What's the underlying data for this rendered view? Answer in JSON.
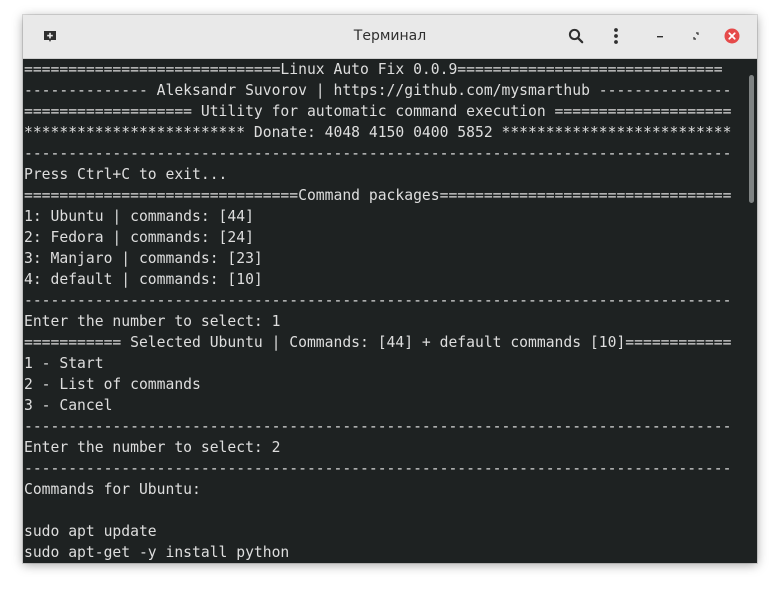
{
  "window": {
    "title": "Терминал"
  },
  "terminal": {
    "lines": [
      "=============================Linux Auto Fix 0.0.9==============================",
      "-------------- Aleksandr Suvorov | https://github.com/mysmarthub ---------------",
      "=================== Utility for automatic command execution ====================",
      "************************* Donate: 4048 4150 0400 5852 **************************",
      "--------------------------------------------------------------------------------",
      "Press Ctrl+C to exit...",
      "===============================Command packages=================================",
      "1: Ubuntu | commands: [44]",
      "2: Fedora | commands: [24]",
      "3: Manjaro | commands: [23]",
      "4: default | commands: [10]",
      "--------------------------------------------------------------------------------",
      "Enter the number to select: 1",
      "=========== Selected Ubuntu | Commands: [44] + default commands [10]============",
      "1 - Start",
      "2 - List of commands",
      "3 - Cancel",
      "--------------------------------------------------------------------------------",
      "Enter the number to select: 2",
      "--------------------------------------------------------------------------------",
      "Commands for Ubuntu:",
      "",
      "sudo apt update",
      "sudo apt-get -y install python"
    ]
  },
  "icons": {
    "new_tab": "new-tab-icon",
    "search": "search-icon",
    "menu": "kebab-menu-icon",
    "minimize": "minimize-icon",
    "restore": "restore-icon",
    "close": "close-icon"
  },
  "colors": {
    "background": "#1e2222",
    "text": "#dedede",
    "titlebar": "#e9e9e9",
    "close_button": "#e54a4a"
  }
}
